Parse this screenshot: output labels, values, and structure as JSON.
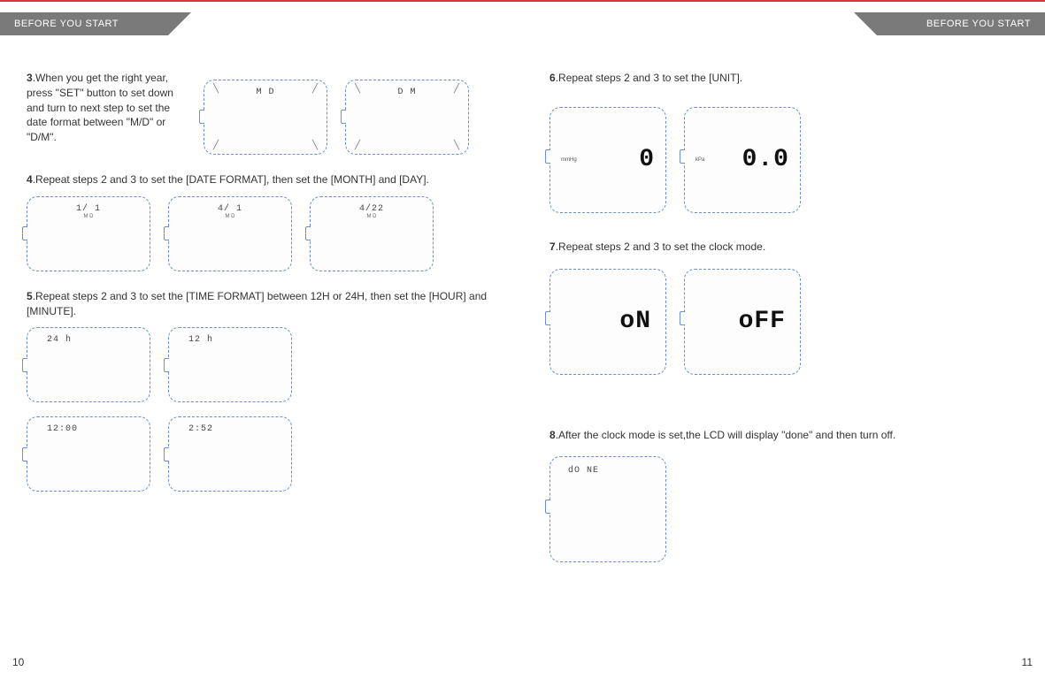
{
  "header": {
    "left_tab": "BEFORE YOU START",
    "right_tab": "BEFORE YOU START"
  },
  "pages": {
    "left_number": "10",
    "right_number": "11"
  },
  "steps": {
    "s3": {
      "num": "3",
      "text": ".When you get the right year, press \"SET\" button to set down and turn to next step to set the date format between \"M/D\" or \"D/M\".",
      "lcd1_top": "M    D",
      "lcd2_top": "D    M"
    },
    "s4": {
      "num": "4",
      "text": ".Repeat steps 2 and 3 to set the [DATE FORMAT], then set the [MONTH] and [DAY].",
      "lcd1": "1/ 1",
      "lcd1_sub": "M   D",
      "lcd2": "4/ 1",
      "lcd2_sub": "M   D",
      "lcd3": "4/22",
      "lcd3_sub": "M   D"
    },
    "s5": {
      "num": "5",
      "text": ".Repeat steps 2 and 3 to set the [TIME FORMAT] between 12H or 24H, then set the [HOUR]  and [MINUTE].",
      "lcd1": "24 h",
      "lcd2": "12 h",
      "lcd3": "12:00",
      "lcd4": "2:52"
    },
    "s6": {
      "num": "6",
      "text": ".Repeat steps 2 and 3 to set the [UNIT].",
      "lcd1_unit": "mmHg",
      "lcd1_val": "0",
      "lcd2_unit": "kPa",
      "lcd2_val": "0.0"
    },
    "s7": {
      "num": "7",
      "text": ".Repeat steps 2 and 3 to set the clock mode.",
      "lcd1": "oN",
      "lcd2": "oFF"
    },
    "s8": {
      "num": "8",
      "text": ".After the clock mode is set,the LCD will display \"done\" and then turn off.",
      "lcd1": "dO NE"
    }
  }
}
